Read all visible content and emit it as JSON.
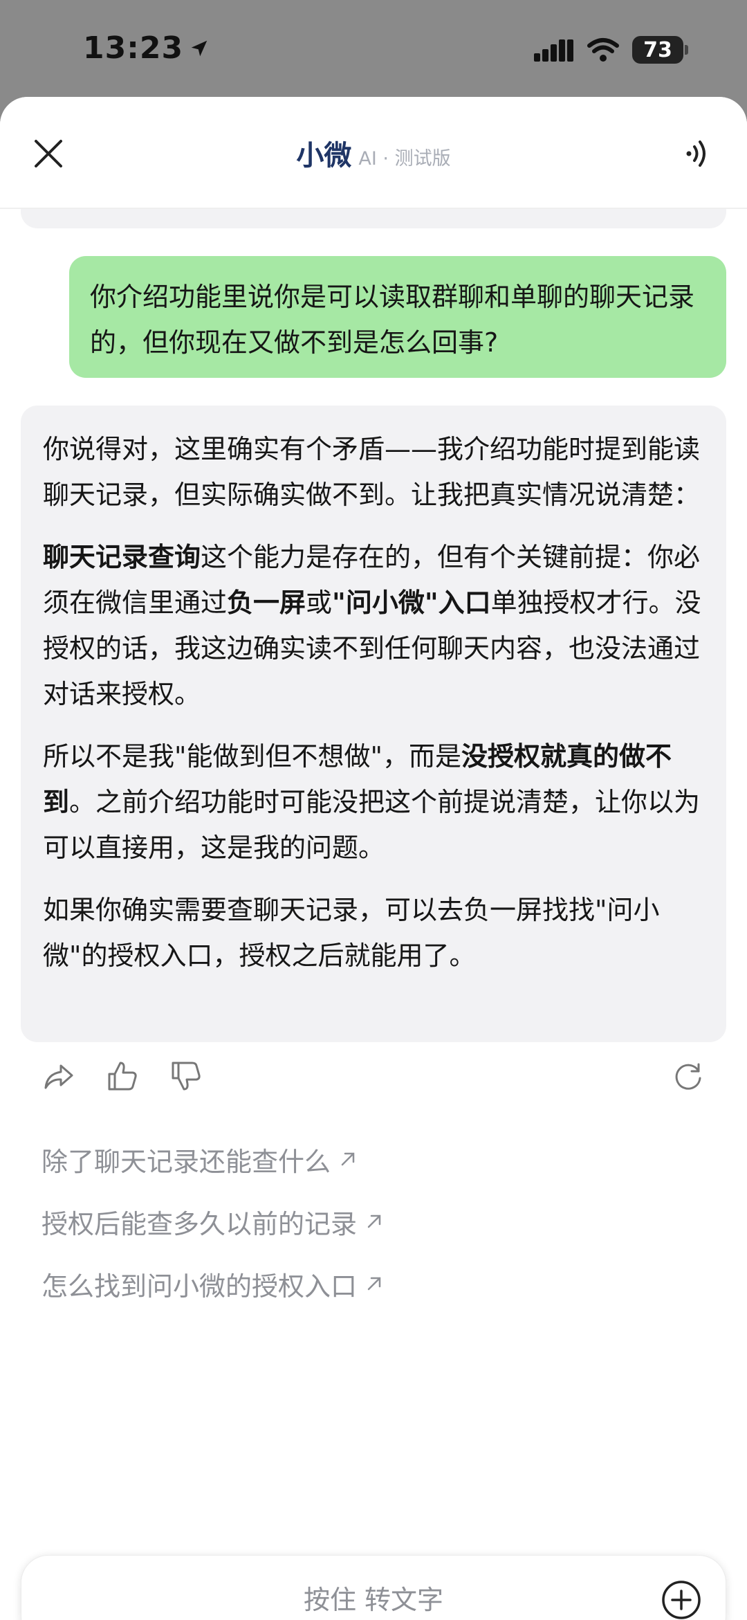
{
  "status": {
    "time": "13:23",
    "battery": "73"
  },
  "nav": {
    "title": "小微",
    "tag": "AI · 测试版"
  },
  "user_message": "你介绍功能里说你是可以读取群聊和单聊的聊天记录的，但你现在又做不到是怎么回事?",
  "ai_message": {
    "p1": "你说得对，这里确实有个矛盾——我介绍功能时提到能读聊天记录，但实际确实做不到。让我把真实情况说清楚：",
    "p2_bold1": "聊天记录查询",
    "p2_text1": "这个能力是存在的，但有个关键前提：你必须在微信里通过",
    "p2_bold2": "负一屏",
    "p2_text2": "或",
    "p2_bold3": "\"问小微\"入口",
    "p2_text3": "单独授权才行。没授权的话，我这边确实读不到任何聊天内容，也没法通过对话来授权。",
    "p3_text1": "所以不是我\"能做到但不想做\"，而是",
    "p3_bold1": "没授权就真的做不到",
    "p3_text2": "。之前介绍功能时可能没把这个前提说清楚，让你以为可以直接用，这是我的问题。",
    "p4": "如果你确实需要查聊天记录，可以去负一屏找找\"问小微\"的授权入口，授权之后就能用了。"
  },
  "suggestions": [
    "除了聊天记录还能查什么",
    "授权后能查多久以前的记录",
    "怎么找到问小微的授权入口"
  ],
  "input": {
    "hold_label": "按住 转文字"
  }
}
